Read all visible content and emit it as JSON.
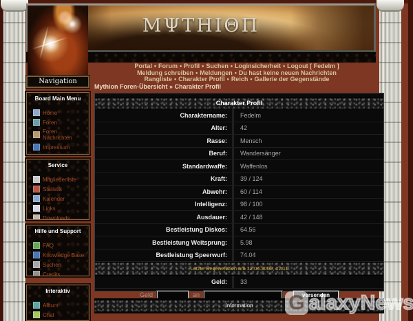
{
  "banner": {
    "title": "MΨTHIΘΠ"
  },
  "nav": {
    "separator": "•",
    "row1": [
      "Portal",
      "Forum",
      "Profil",
      "Suchen",
      "Loginsicherheit",
      "Logout [ Fedelm ]"
    ],
    "row2": [
      "Meldung schreiben",
      "Meldungen",
      "Du hast keine neuen Nachrichten"
    ],
    "row3": [
      "Rangliste",
      "Charakter Profil",
      "Reich",
      "Gallerie der Gegenstände"
    ]
  },
  "breadcrumb": "Mythion Foren-Übersicht » Charakter Profil",
  "sidebar": {
    "navigation_title": "Navigation",
    "sections": [
      {
        "title": "Board Main Menu",
        "items": [
          {
            "label": "Home",
            "icon_color": "#8fa8c8"
          },
          {
            "label": "Foren",
            "icon_color": "#6aa0a8"
          },
          {
            "label": "Foren Nachrichten",
            "icon_color": "#b89868"
          },
          {
            "label": "Impressum",
            "icon_color": "#4878b8"
          }
        ]
      },
      {
        "title": "Service",
        "items": [
          {
            "label": "Mitgliederliste",
            "icon_color": "#c8c8c8"
          },
          {
            "label": "Statistik",
            "icon_color": "#b85840"
          },
          {
            "label": "Kalender",
            "icon_color": "#88a8d0"
          },
          {
            "label": "Links",
            "icon_color": "#d8d8e8"
          },
          {
            "label": "Downloads",
            "icon_color": "#c0b8a8"
          }
        ]
      },
      {
        "title": "Hilfe und Support",
        "items": [
          {
            "label": "FAQ",
            "icon_color": "#68a858"
          },
          {
            "label": "Knowledge Base",
            "icon_color": "#4878b8"
          },
          {
            "label": "Suchen",
            "icon_color": "#a8a8a8"
          },
          {
            "label": "Credits",
            "icon_color": "#909090"
          }
        ]
      },
      {
        "title": "Interaktiv",
        "items": [
          {
            "label": "Album",
            "icon_color": "#58a8a0"
          },
          {
            "label": "Chat",
            "icon_color": "#a8c858"
          }
        ]
      }
    ]
  },
  "profile": {
    "title": "Charakter Profil",
    "rows": [
      {
        "label": "Charaktername:",
        "value": "Fedelm"
      },
      {
        "label": "Alter:",
        "value": "42"
      },
      {
        "label": "Rasse:",
        "value": "Mensch"
      },
      {
        "label": "Beruf:",
        "value": "Wandersänger"
      },
      {
        "label": "Standardwaffe:",
        "value": "Waffenlos"
      },
      {
        "label": "Kraft:",
        "value": "39 / 124"
      },
      {
        "label": "Abwehr:",
        "value": "60 / 114"
      },
      {
        "label": "Intelligenz:",
        "value": "98 / 100"
      },
      {
        "label": "Ausdauer:",
        "value": "42 / 148"
      },
      {
        "label": "Bestleistung Diskos:",
        "value": "64.56"
      },
      {
        "label": "Bestleistung Weitsprung:",
        "value": "5.98"
      },
      {
        "label": "Bestleistung Speerwurf:",
        "value": "74.04"
      }
    ],
    "regeneration_note": "Letzte Regeneration am 12.04.2009, 12:11",
    "geld_row": {
      "label": "Geld:",
      "value": "33"
    },
    "transfer_form": {
      "geld_label": "Geld",
      "an_label": "an",
      "submit_label": "versenden"
    }
  },
  "footer": {
    "information_title": "Information"
  },
  "watermark": {
    "g": "G",
    "rest": "alaxyNews"
  },
  "colors": {
    "page_bg": "#7d3722",
    "accent_gold": "#8a6a40",
    "regen_text": "#cfa733",
    "link_rust": "#a34b26",
    "nav_cream": "#d9c49c"
  }
}
